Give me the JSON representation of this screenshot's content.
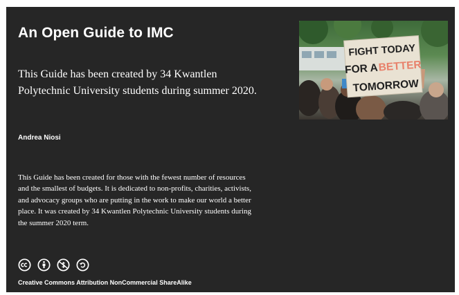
{
  "book": {
    "title": "An Open Guide to IMC",
    "subtitle": "This Guide has been created by 34 Kwantlen Polytechnic University students during summer 2020.",
    "author": "Andrea Niosi",
    "description": "This Guide has been created for those with the fewest number of resources and the smallest of budgets. It is dedicated to non-profits, charities, activists, and advocacy groups who are putting in the work to make our world a better place. It was created by 34 Kwantlen Polytechnic University students during the summer 2020 term.",
    "license_label": "Creative Commons Attribution NonCommercial ShareAlike"
  },
  "cover_image": {
    "sign_line_1": "FIGHT TODAY",
    "sign_line_2_prefix": "FOR A",
    "sign_line_2_highlight": "BETTER",
    "sign_line_3": "TOMORROW"
  },
  "license_icons": [
    "creative-commons-icon",
    "attribution-icon",
    "noncommercial-icon",
    "sharealike-icon"
  ],
  "colors": {
    "card_background": "#262626",
    "text": "#ffffff",
    "sign_background": "#e9e2d3",
    "sign_ink": "#1f1f1f",
    "sign_highlight": "#e8806a"
  }
}
